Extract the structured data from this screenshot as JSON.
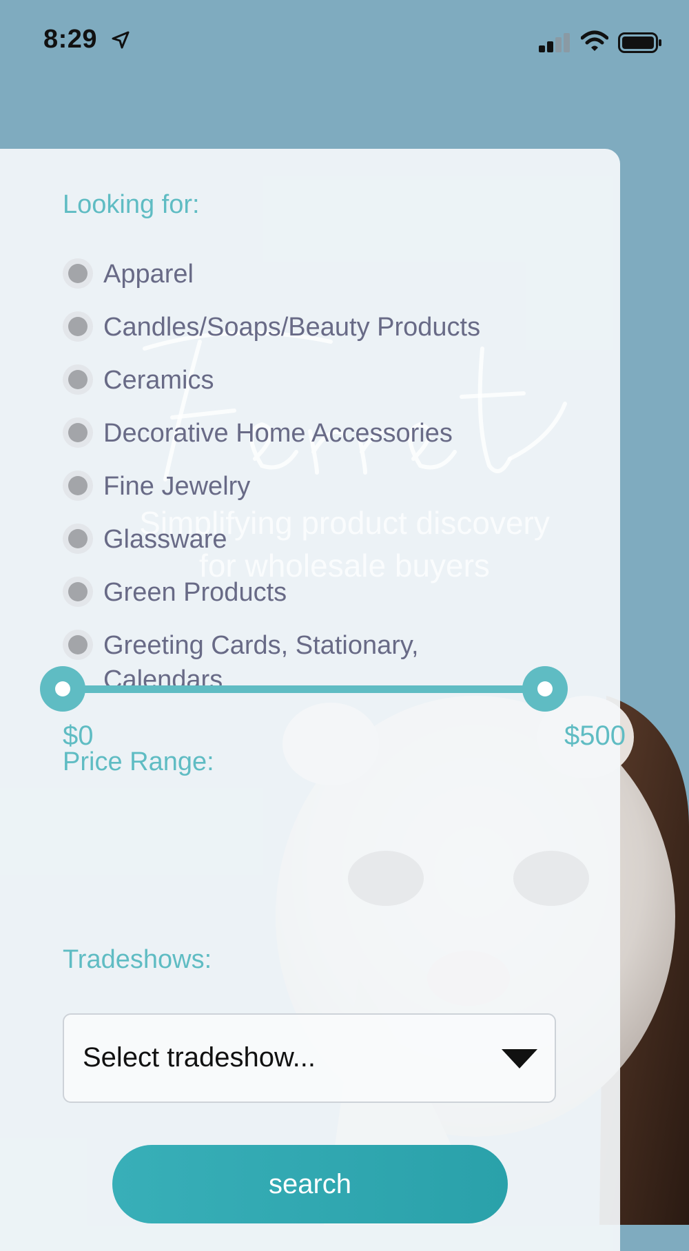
{
  "status_bar": {
    "time": "8:29",
    "icons": [
      "location-arrow-icon",
      "cellular-signal-icon",
      "wifi-icon",
      "battery-icon"
    ]
  },
  "branding": {
    "logo_text": "Ferret",
    "tagline_line1": "Simplifying product discovery",
    "tagline_line2": "for wholesale buyers"
  },
  "filters": {
    "looking_for_title": "Looking for:",
    "categories": [
      {
        "label": "Apparel"
      },
      {
        "label": "Candles/Soaps/Beauty Products"
      },
      {
        "label": "Ceramics"
      },
      {
        "label": "Decorative Home Accessories"
      },
      {
        "label": "Fine Jewelry"
      },
      {
        "label": "Glassware"
      },
      {
        "label": "Green Products"
      },
      {
        "label": "Greeting Cards, Stationary, Calendars"
      }
    ],
    "price_title": "Price Range:",
    "price_min": "$0",
    "price_max": "$500",
    "price_low_fraction": 0,
    "price_high_fraction": 1,
    "tradeshows_title": "Tradeshows:",
    "tradeshow_select_value": "Select tradeshow...",
    "search_label": "search"
  },
  "colors": {
    "accent": "#5fbcc3",
    "button": "#2aa1aa",
    "label_text": "#686a86",
    "background": "#7fabbf"
  }
}
